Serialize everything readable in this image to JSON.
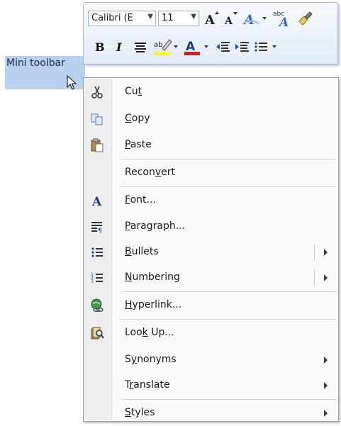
{
  "selection": {
    "text": "Mini toolbar"
  },
  "mini_toolbar": {
    "font_name": "Calibri (E",
    "font_size": "11",
    "clear_format_label": "abc"
  },
  "context_menu": {
    "items": [
      {
        "label": "Cut",
        "mnemonic": "t",
        "icon": "scissors-icon"
      },
      {
        "label": "Copy",
        "mnemonic": "C",
        "icon": "copy-icon"
      },
      {
        "label": "Paste",
        "mnemonic": "P",
        "icon": "paste-icon"
      },
      {
        "label": "Reconvert",
        "mnemonic": "V",
        "icon": ""
      },
      {
        "label": "Font...",
        "mnemonic": "F",
        "icon": "font-icon"
      },
      {
        "label": "Paragraph...",
        "mnemonic": "P",
        "icon": "paragraph-icon"
      },
      {
        "label": "Bullets",
        "mnemonic": "B",
        "icon": "bullets-icon",
        "submenu": true
      },
      {
        "label": "Numbering",
        "mnemonic": "N",
        "icon": "numbering-icon",
        "submenu": true
      },
      {
        "label": "Hyperlink...",
        "mnemonic": "H",
        "icon": "hyperlink-icon"
      },
      {
        "label": "Look Up...",
        "mnemonic": "K",
        "icon": "lookup-icon"
      },
      {
        "label": "Synonyms",
        "mnemonic": "Y",
        "icon": "",
        "submenu": true
      },
      {
        "label": "Translate",
        "mnemonic": "R",
        "icon": "",
        "submenu": true
      },
      {
        "label": "Styles",
        "mnemonic": "T",
        "icon": "",
        "submenu": true
      }
    ]
  }
}
